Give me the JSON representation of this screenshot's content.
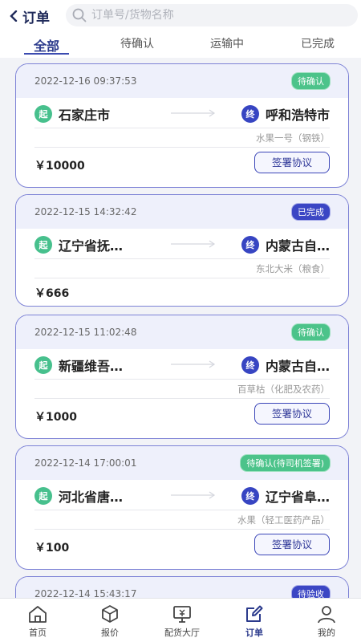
{
  "header": {
    "back_label": "订单",
    "search_placeholder": "订单号/货物名称"
  },
  "tabs": [
    "全部",
    "待确认",
    "运输中",
    "已完成"
  ],
  "route_labels": {
    "from": "起",
    "to": "终"
  },
  "orders": [
    {
      "time": "2022-12-16 09:37:53",
      "status": "待确认",
      "status_color": "green",
      "from": "石家庄市",
      "to": "呼和浩特市",
      "cargo": "水果一号（钢铁）",
      "price": "￥10000",
      "action": "签署协议"
    },
    {
      "time": "2022-12-15 14:32:42",
      "status": "已完成",
      "status_color": "blue",
      "from": "辽宁省抚…",
      "to": "内蒙古自…",
      "cargo": "东北大米（粮食）",
      "price": "￥666",
      "action": ""
    },
    {
      "time": "2022-12-15 11:02:48",
      "status": "待确认",
      "status_color": "green",
      "from": "新疆维吾…",
      "to": "内蒙古自…",
      "cargo": "百草枯（化肥及农药）",
      "price": "￥1000",
      "action": "签署协议"
    },
    {
      "time": "2022-12-14 17:00:01",
      "status": "待确认(待司机签署)",
      "status_color": "green",
      "from": "河北省唐…",
      "to": "辽宁省阜…",
      "cargo": "水果（轻工医药产品）",
      "price": "￥100",
      "action": "签署协议"
    },
    {
      "time": "2022-12-14 15:43:17",
      "status": "待验收",
      "status_color": "blue"
    }
  ],
  "tabbar": [
    {
      "label": "首页",
      "icon": "home-icon"
    },
    {
      "label": "报价",
      "icon": "box-icon"
    },
    {
      "label": "配货大厅",
      "icon": "monitor-icon"
    },
    {
      "label": "订单",
      "icon": "edit-icon"
    },
    {
      "label": "我的",
      "icon": "user-icon"
    }
  ],
  "colors": {
    "primary": "#3b46c4",
    "green": "#47c08d",
    "card_border": "#7d82d6"
  }
}
